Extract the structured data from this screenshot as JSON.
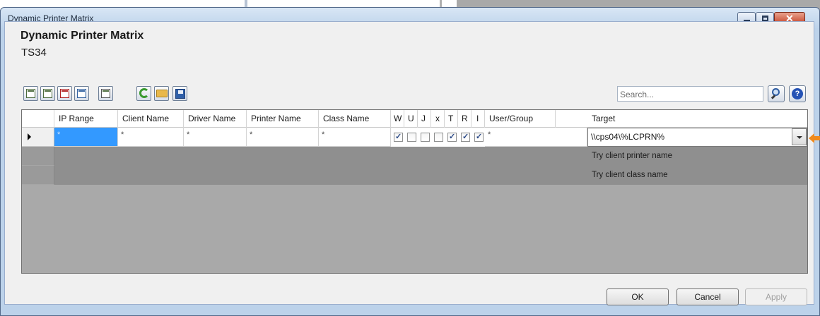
{
  "window": {
    "title": "Dynamic Printer Matrix"
  },
  "header": {
    "title": "Dynamic Printer Matrix",
    "subtitle": "TS34"
  },
  "toolbar": {
    "icons": [
      "add-row-icon",
      "add-row-after-icon",
      "delete-row-icon",
      "move-row-icon",
      "table-icon",
      "refresh-icon",
      "open-folder-icon",
      "save-icon"
    ]
  },
  "search": {
    "placeholder": "Search..."
  },
  "grid": {
    "columns": [
      "IP Range",
      "Client Name",
      "Driver Name",
      "Printer Name",
      "Class Name",
      "W",
      "U",
      "J",
      "x",
      "T",
      "R",
      "I",
      "User/Group",
      "Target"
    ],
    "rows": [
      {
        "ip_range": "*",
        "client_name": "*",
        "driver_name": "*",
        "printer_name": "*",
        "class_name": "*",
        "W": true,
        "U": false,
        "J": false,
        "x": false,
        "T": true,
        "R": true,
        "I": true,
        "user_group": "*",
        "target": "\\\\cps04\\%LCPRN%"
      }
    ],
    "target_options": [
      "Try client printer name",
      "Try client class name"
    ]
  },
  "buttons": {
    "ok": "OK",
    "cancel": "Cancel",
    "apply": "Apply"
  },
  "colors": {
    "selection": "#3399ff",
    "arrow": "#f08a1c"
  }
}
